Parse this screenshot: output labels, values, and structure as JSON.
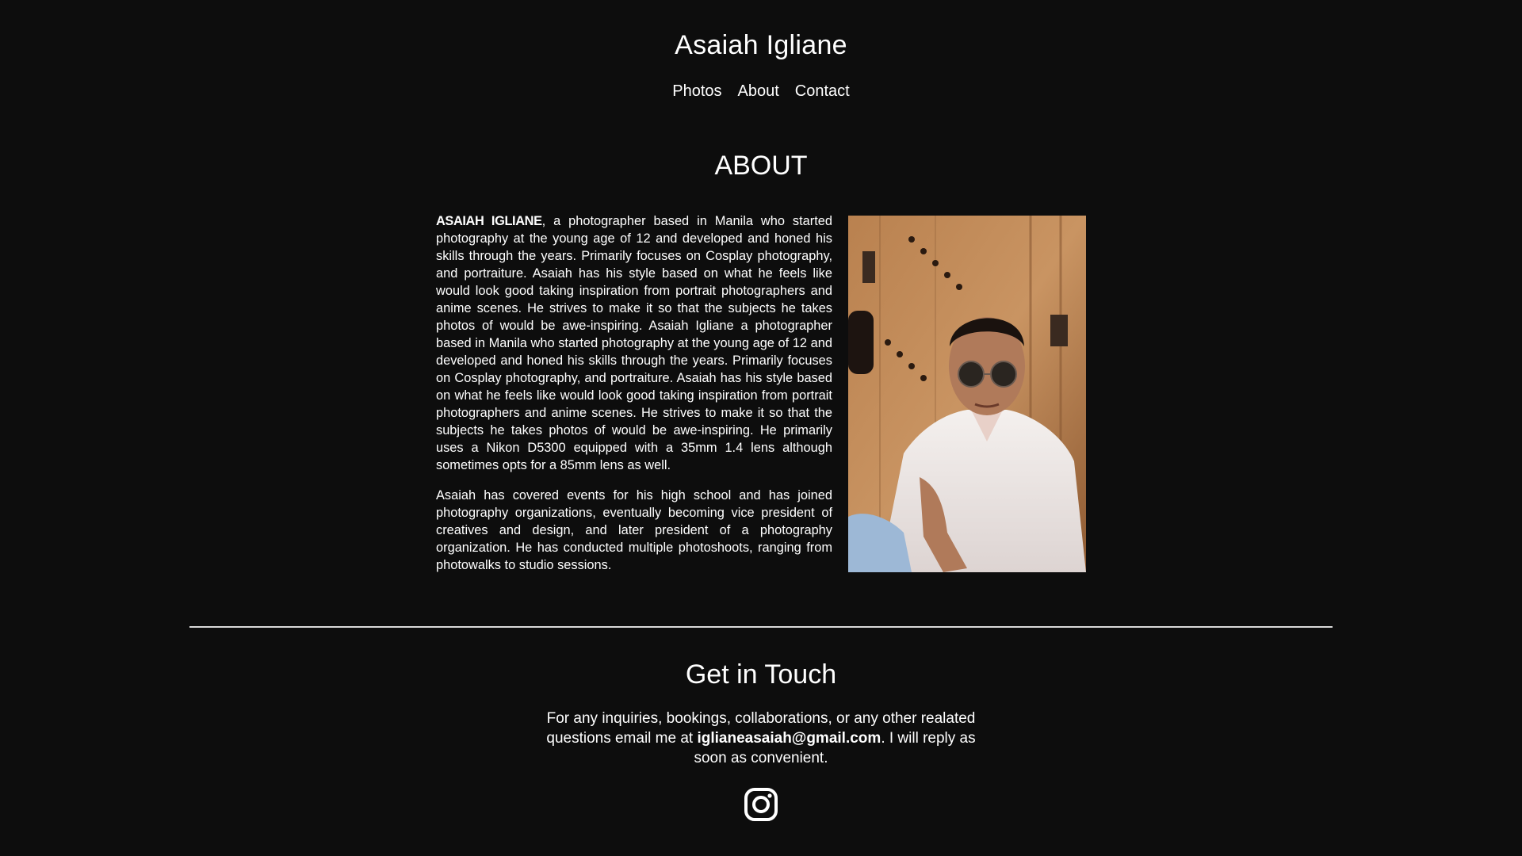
{
  "site": {
    "title": "Asaiah Igliane"
  },
  "nav": {
    "items": [
      "Photos",
      "About",
      "Contact"
    ]
  },
  "about": {
    "heading": "ABOUT",
    "name_bold": "ASAIAH IGLIANE",
    "paragraph1_rest": ", a photographer based in Manila who started photography at the young age of 12 and developed and honed his skills through the years. Primarily focuses on Cosplay photography, and portraiture. Asaiah has his style based on what he feels like would look good taking inspiration from portrait photographers and anime scenes. He strives to make it so that the subjects he takes photos of would be awe-inspiring. Asaiah Igliane a photographer based in Manila who started photography at the young age of 12 and developed and honed his skills through the years. Primarily focuses on Cosplay photography, and portraiture. Asaiah has his style based on what he feels like would look good taking inspiration from portrait photographers and anime scenes. He strives to make it so that the subjects he takes photos of would be awe-inspiring. He primarily uses a Nikon D5300 equipped with a 35mm 1.4 lens although sometimes opts for a 85mm lens as well.",
    "paragraph2": "Asaiah has covered events for his high school and has joined photography organizations, eventually becoming vice president of creatives and design, and later president of a photography organization. He has conducted multiple photoshoots, ranging from photowalks to studio sessions."
  },
  "contact": {
    "heading": "Get in Touch",
    "text_before": "For any inquiries, bookings, collaborations, or any other realated questions email me at ",
    "email": "iglianeasaiah@gmail.com",
    "text_after": ". I will reply as soon as convenient.",
    "icon": "instagram-icon"
  },
  "colors": {
    "background": "#0d0d0d",
    "text": "#ffffff",
    "divider": "#d9d9d9"
  }
}
